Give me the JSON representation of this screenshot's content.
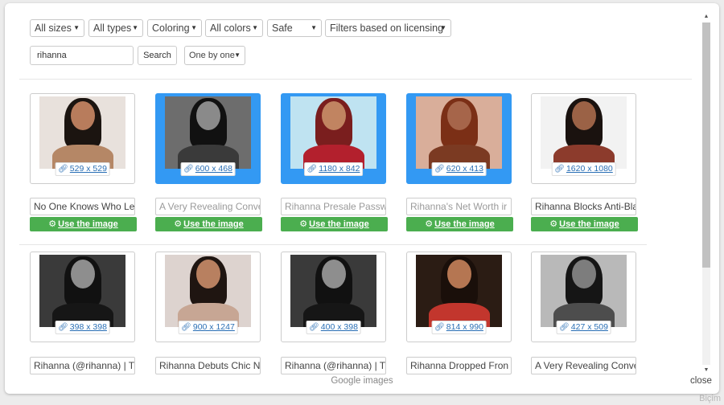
{
  "filters": {
    "sizes": "All sizes",
    "types": "All types",
    "coloring": "Coloring",
    "colors": "All colors",
    "safe": "Safe",
    "licensing": "Filters based on licensing",
    "mode": "One by one"
  },
  "search": {
    "value": "rihanna",
    "button": "Search"
  },
  "use_label": "Use the image",
  "row1": [
    {
      "size": "529 x 529",
      "title": "No One Knows Who Le",
      "faded": false,
      "selected": false,
      "bg": "#e8e1dc",
      "hair": "#1b1410",
      "skin": "#b87c5c",
      "body": "#b58766"
    },
    {
      "size": "600 x 468",
      "title": "A Very Revealing Conve",
      "faded": true,
      "selected": true,
      "bg": "#6d6d6d",
      "hair": "#111111",
      "skin": "#8a8a8a",
      "body": "#3a3a3a"
    },
    {
      "size": "1180 x 842",
      "title": "Rihanna Presale Passw",
      "faded": true,
      "selected": true,
      "bg": "#bfe3f1",
      "hair": "#7a1e1e",
      "skin": "#c18461",
      "body": "#b3202d"
    },
    {
      "size": "620 x 413",
      "title": "Rihanna's Net Worth ir",
      "faded": true,
      "selected": true,
      "bg": "#d9ae9a",
      "hair": "#7b2f16",
      "skin": "#a6654a",
      "body": "#7b3a22"
    },
    {
      "size": "1620 x 1080",
      "title": "Rihanna Blocks Anti-Bla",
      "faded": false,
      "selected": false,
      "bg": "#f2f2f2",
      "hair": "#1a120f",
      "skin": "#9b6246",
      "body": "#8c3b2c"
    }
  ],
  "row2": [
    {
      "size": "398 x 398",
      "title": "Rihanna (@rihanna) | T",
      "faded": false,
      "selected": false,
      "bg": "#3a3a3a",
      "hair": "#111111",
      "skin": "#8e8e8e",
      "body": "#161616"
    },
    {
      "size": "900 x 1247",
      "title": "Rihanna Debuts Chic N",
      "faded": false,
      "selected": false,
      "bg": "#ddd3cf",
      "hair": "#1f1511",
      "skin": "#b88060",
      "body": "#c7a694"
    },
    {
      "size": "400 x 398",
      "title": "Rihanna (@rihanna) | T",
      "faded": false,
      "selected": false,
      "bg": "#3a3a3a",
      "hair": "#111111",
      "skin": "#8e8e8e",
      "body": "#161616"
    },
    {
      "size": "814 x 990",
      "title": "Rihanna Dropped Fron",
      "faded": false,
      "selected": false,
      "bg": "#2b1c14",
      "hair": "#1a0f0a",
      "skin": "#b57652",
      "body": "#c2362d"
    },
    {
      "size": "427 x 509",
      "title": "A Very Revealing Conve",
      "faded": false,
      "selected": false,
      "bg": "#b9b9b9",
      "hair": "#151515",
      "skin": "#7d7d7d",
      "body": "#4d4d4d"
    }
  ],
  "footer": "Google images",
  "close": "close",
  "bg_hint": "Biçim"
}
